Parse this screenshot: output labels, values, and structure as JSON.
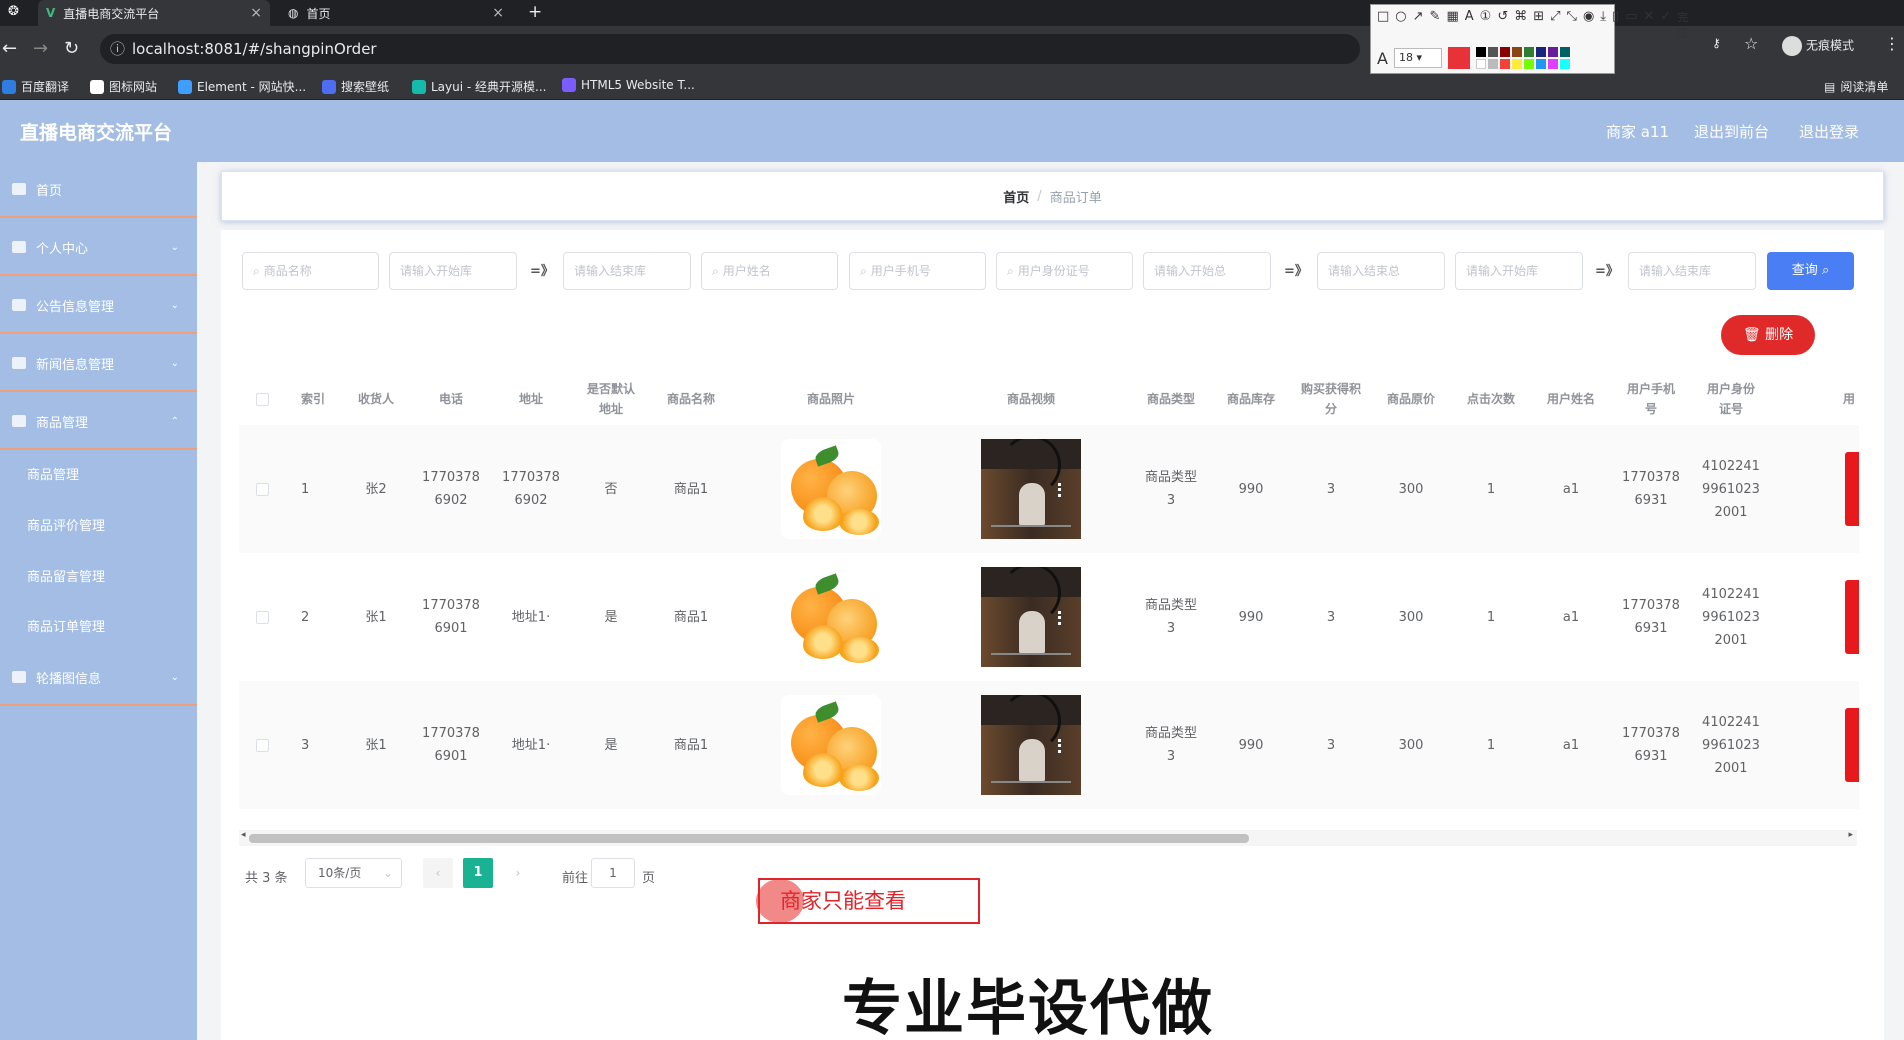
{
  "browser": {
    "tabs": [
      {
        "label": "直播电商交流平台",
        "active": true
      },
      {
        "label": "首页",
        "active": false
      }
    ],
    "url": "localhost:8081/#/shangpinOrder",
    "bookmarks": [
      {
        "label": "百度翻译",
        "color": "#2f7de1"
      },
      {
        "label": "图标网站",
        "color": "#ffffff"
      },
      {
        "label": "Element - 网站快...",
        "color": "#409eff"
      },
      {
        "label": "搜索壁纸",
        "color": "#4e6ef2"
      },
      {
        "label": "Layui - 经典开源模...",
        "color": "#16baaa"
      },
      {
        "label": "HTML5 Website T...",
        "color": "#7b5cff"
      }
    ],
    "reading_list": "阅读清单",
    "incognito": "无痕模式",
    "annot_done": "完成",
    "annot_font_size": "18"
  },
  "header": {
    "title": "直播电商交流平台",
    "user": "商家 a11",
    "back_to_front": "退出到前台",
    "logout": "退出登录"
  },
  "sidebar": {
    "items": [
      {
        "label": "首页"
      },
      {
        "label": "个人中心"
      },
      {
        "label": "公告信息管理"
      },
      {
        "label": "新闻信息管理"
      },
      {
        "label": "商品管理"
      }
    ],
    "subitems": [
      {
        "label": "商品管理"
      },
      {
        "label": "商品评价管理"
      },
      {
        "label": "商品留言管理"
      },
      {
        "label": "商品订单管理"
      }
    ],
    "last_item": "轮播图信息"
  },
  "breadcrumb": {
    "home": "首页",
    "current": "商品订单"
  },
  "search": {
    "inputs": [
      {
        "placeholder": "商品名称",
        "icon": true
      },
      {
        "placeholder": "请输入开始库",
        "icon": false
      },
      {
        "placeholder": "请输入结束库",
        "icon": false
      },
      {
        "placeholder": "用户姓名",
        "icon": true
      },
      {
        "placeholder": "用户手机号",
        "icon": true
      },
      {
        "placeholder": "用户身份证号",
        "icon": true
      },
      {
        "placeholder": "请输入开始总",
        "icon": false
      },
      {
        "placeholder": "请输入结束总",
        "icon": false
      },
      {
        "placeholder": "请输入开始库",
        "icon": false
      },
      {
        "placeholder": "请输入结束库",
        "icon": false
      }
    ],
    "range_sep": "=》",
    "query_label": "查询"
  },
  "actions": {
    "delete_label": "删除",
    "delete_color": "#e02a2a",
    "query_color": "#4a7ef5"
  },
  "table": {
    "headers": [
      "索引",
      "收货人",
      "电话",
      "地址",
      "是否默认地址",
      "商品名称",
      "商品照片",
      "商品视频",
      "商品类型",
      "商品库存",
      "购买获得积分",
      "商品原价",
      "点击次数",
      "用户姓名",
      "用户手机号",
      "用户身份证号",
      "用"
    ],
    "rows": [
      {
        "index": "1",
        "receiver": "张2",
        "phone": "17703786902",
        "address": "17703786902",
        "is_default": "否",
        "product_name": "商品1",
        "product_type": "商品类型3",
        "stock": "990",
        "points": "3",
        "price": "300",
        "clicks": "1",
        "user_name": "a1",
        "user_phone": "17703786931",
        "user_id": "410224199610232001"
      },
      {
        "index": "2",
        "receiver": "张1",
        "phone": "17703786901",
        "address": "地址1·",
        "is_default": "是",
        "product_name": "商品1",
        "product_type": "商品类型3",
        "stock": "990",
        "points": "3",
        "price": "300",
        "clicks": "1",
        "user_name": "a1",
        "user_phone": "17703786931",
        "user_id": "410224199610232001"
      },
      {
        "index": "3",
        "receiver": "张1",
        "phone": "17703786901",
        "address": "地址1·",
        "is_default": "是",
        "product_name": "商品1",
        "product_type": "商品类型3",
        "stock": "990",
        "points": "3",
        "price": "300",
        "clicks": "1",
        "user_name": "a1",
        "user_phone": "17703786931",
        "user_id": "410224199610232001"
      }
    ]
  },
  "pagination": {
    "total": "共 3 条",
    "page_size": "10条/页",
    "current": "1",
    "goto": "前往",
    "goto_value": "1",
    "page_unit": "页",
    "active_color": "#19b394"
  },
  "annotation": {
    "note": "商家只能查看",
    "watermark": "专业毕设代做"
  }
}
